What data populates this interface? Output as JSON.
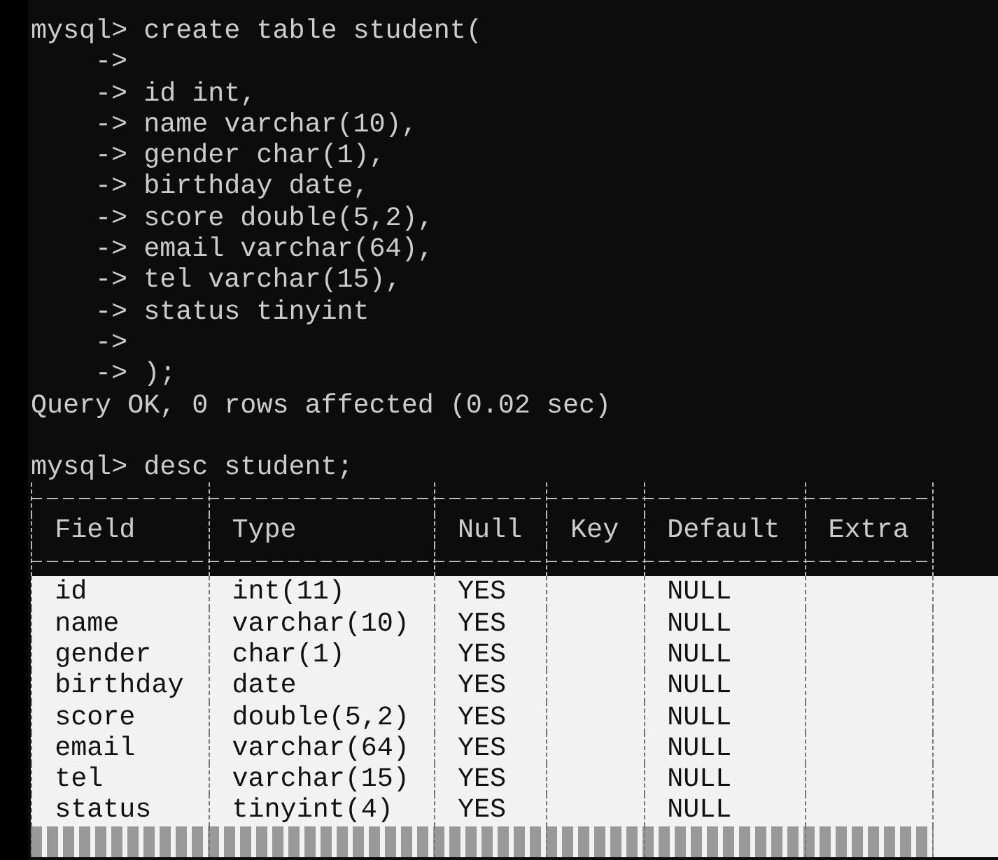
{
  "terminal": {
    "lines": [
      {
        "kind": "prompt",
        "prompt": "mysql>",
        "text": "create table student("
      },
      {
        "kind": "continuation",
        "prompt": "->"
      },
      {
        "kind": "continuation",
        "prompt": "->",
        "text": "id int,"
      },
      {
        "kind": "continuation",
        "prompt": "->",
        "text": "name varchar(10),"
      },
      {
        "kind": "continuation",
        "prompt": "->",
        "text": "gender char(1),"
      },
      {
        "kind": "continuation",
        "prompt": "->",
        "text": "birthday date,"
      },
      {
        "kind": "continuation",
        "prompt": "->",
        "text": "score double(5,2),"
      },
      {
        "kind": "continuation",
        "prompt": "->",
        "text": "email varchar(64),"
      },
      {
        "kind": "continuation",
        "prompt": "->",
        "text": "tel varchar(15),"
      },
      {
        "kind": "continuation",
        "prompt": "->",
        "text": "status tinyint"
      },
      {
        "kind": "continuation",
        "prompt": "->"
      },
      {
        "kind": "continuation",
        "prompt": "->",
        "text": ");"
      },
      {
        "kind": "output",
        "text": "Query OK, 0 rows affected (0.02 sec)"
      },
      {
        "kind": "blank"
      },
      {
        "kind": "prompt",
        "prompt": "mysql>",
        "text": "desc student;"
      }
    ],
    "table": {
      "columns": [
        "Field",
        "Type",
        "Null",
        "Key",
        "Default",
        "Extra"
      ],
      "rows": [
        {
          "selected": true,
          "cells": [
            "id",
            "int(11)",
            "YES",
            null,
            "NULL",
            null
          ]
        },
        {
          "selected": true,
          "cells": [
            "name",
            "varchar(10)",
            "YES",
            null,
            "NULL",
            null
          ]
        },
        {
          "selected": true,
          "cells": [
            "gender",
            "char(1)",
            "YES",
            null,
            "NULL",
            null
          ]
        },
        {
          "selected": true,
          "cells": [
            "birthday",
            "date",
            "YES",
            null,
            "NULL",
            null
          ]
        },
        {
          "selected": true,
          "cells": [
            "score",
            "double(5,2)",
            "YES",
            null,
            "NULL",
            null
          ]
        },
        {
          "selected": true,
          "cells": [
            "email",
            "varchar(64)",
            "YES",
            null,
            "NULL",
            null
          ]
        },
        {
          "selected": true,
          "cells": [
            "tel",
            "varchar(15)",
            "YES",
            null,
            "NULL",
            null
          ]
        },
        {
          "selected": true,
          "cells": [
            "status",
            "tinyint(4)",
            "YES",
            null,
            "NULL",
            null
          ]
        }
      ]
    }
  }
}
